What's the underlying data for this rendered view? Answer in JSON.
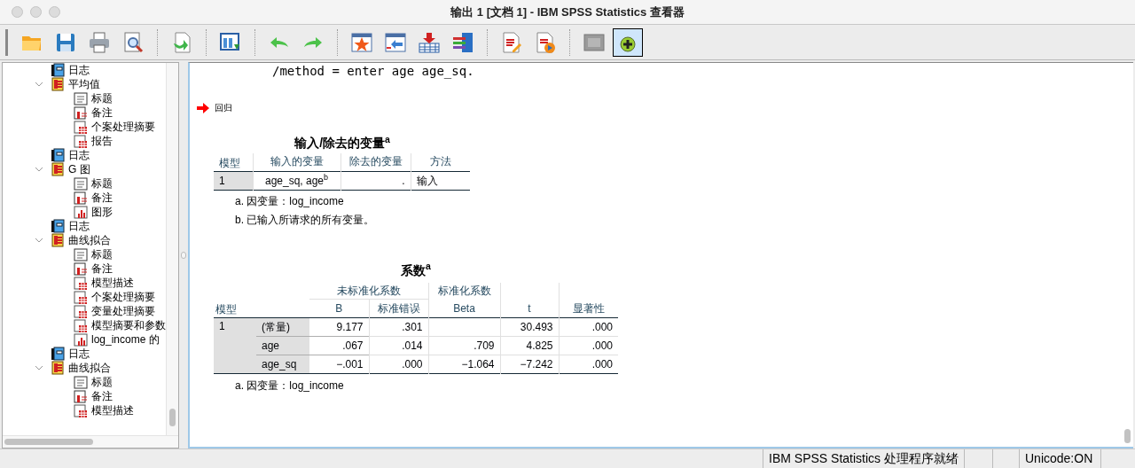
{
  "window": {
    "title": "输出 1 [文档 1] - IBM SPSS Statistics 查看器"
  },
  "toolbar": [
    {
      "kind": "open"
    },
    {
      "kind": "save"
    },
    {
      "kind": "print"
    },
    {
      "kind": "preview"
    },
    {
      "kind": "separator"
    },
    {
      "kind": "goto"
    },
    {
      "kind": "separator"
    },
    {
      "kind": "pane"
    },
    {
      "kind": "separator"
    },
    {
      "kind": "undo"
    },
    {
      "kind": "redo"
    },
    {
      "kind": "separator"
    },
    {
      "kind": "star"
    },
    {
      "kind": "back"
    },
    {
      "kind": "insert"
    },
    {
      "kind": "vars"
    },
    {
      "kind": "separator"
    },
    {
      "kind": "edit"
    },
    {
      "kind": "play"
    },
    {
      "kind": "separator"
    },
    {
      "kind": "gray"
    },
    {
      "kind": "add",
      "pressed": true
    }
  ],
  "tree": [
    {
      "kind": "log",
      "label": "日志"
    },
    {
      "kind": "group",
      "label": "平均值",
      "expanded": true,
      "children": [
        {
          "kind": "title",
          "label": "标题"
        },
        {
          "kind": "notes",
          "label": "备注"
        },
        {
          "kind": "table",
          "label": "个案处理摘要"
        },
        {
          "kind": "table",
          "label": "报告"
        }
      ]
    },
    {
      "kind": "log",
      "label": "日志"
    },
    {
      "kind": "group",
      "label": "G 图",
      "expanded": true,
      "children": [
        {
          "kind": "title",
          "label": "标题"
        },
        {
          "kind": "notes",
          "label": "备注"
        },
        {
          "kind": "chart",
          "label": "图形"
        }
      ]
    },
    {
      "kind": "log",
      "label": "日志"
    },
    {
      "kind": "group",
      "label": "曲线拟合",
      "expanded": true,
      "children": [
        {
          "kind": "title",
          "label": "标题"
        },
        {
          "kind": "notes",
          "label": "备注"
        },
        {
          "kind": "table",
          "label": "模型描述"
        },
        {
          "kind": "table",
          "label": "个案处理摘要"
        },
        {
          "kind": "table",
          "label": "变量处理摘要"
        },
        {
          "kind": "table",
          "label": "模型摘要和参数"
        },
        {
          "kind": "chart",
          "label": "log_income 的"
        }
      ]
    },
    {
      "kind": "log",
      "label": "日志"
    },
    {
      "kind": "group",
      "label": "曲线拟合",
      "expanded": true,
      "children": [
        {
          "kind": "title",
          "label": "标题"
        },
        {
          "kind": "notes",
          "label": "备注"
        },
        {
          "kind": "table",
          "label": "模型描述"
        }
      ]
    }
  ],
  "output": {
    "syntax": "/method = enter age age_sq.",
    "heading": "回归",
    "table_1": {
      "title": "输入/除去的变量$^{a}$",
      "columns": [
        "模型",
        "输入的变量",
        "除去的变量",
        "方法"
      ],
      "rows": [
        [
          "1",
          "age_sq, age$^{b}$",
          ".",
          "输入"
        ]
      ],
      "footnotes": [
        "a. 因变量：log_income",
        "b. 已输入所请求的所有变量。"
      ]
    },
    "table_2": {
      "title": "系数$^{a}$",
      "column_groups": [
        "未标准化系数",
        "标准化系数"
      ],
      "columns": [
        "模型",
        "B",
        "标准错误",
        "Beta",
        "t",
        "显著性"
      ],
      "model": "1",
      "rows": [
        [
          "(常量)",
          "9.177",
          ".301",
          "",
          "30.493",
          ".000"
        ],
        [
          "age",
          ".067",
          ".014",
          ".709",
          "4.825",
          ".000"
        ],
        [
          "age_sq",
          "−.001",
          ".000",
          "−1.064",
          "−7.242",
          ".000"
        ]
      ],
      "footnotes": [
        "a. 因变量：log_income"
      ]
    }
  },
  "status_bar": {
    "message": "IBM SPSS Statistics 处理程序就绪",
    "encoding": "Unicode:ON"
  }
}
